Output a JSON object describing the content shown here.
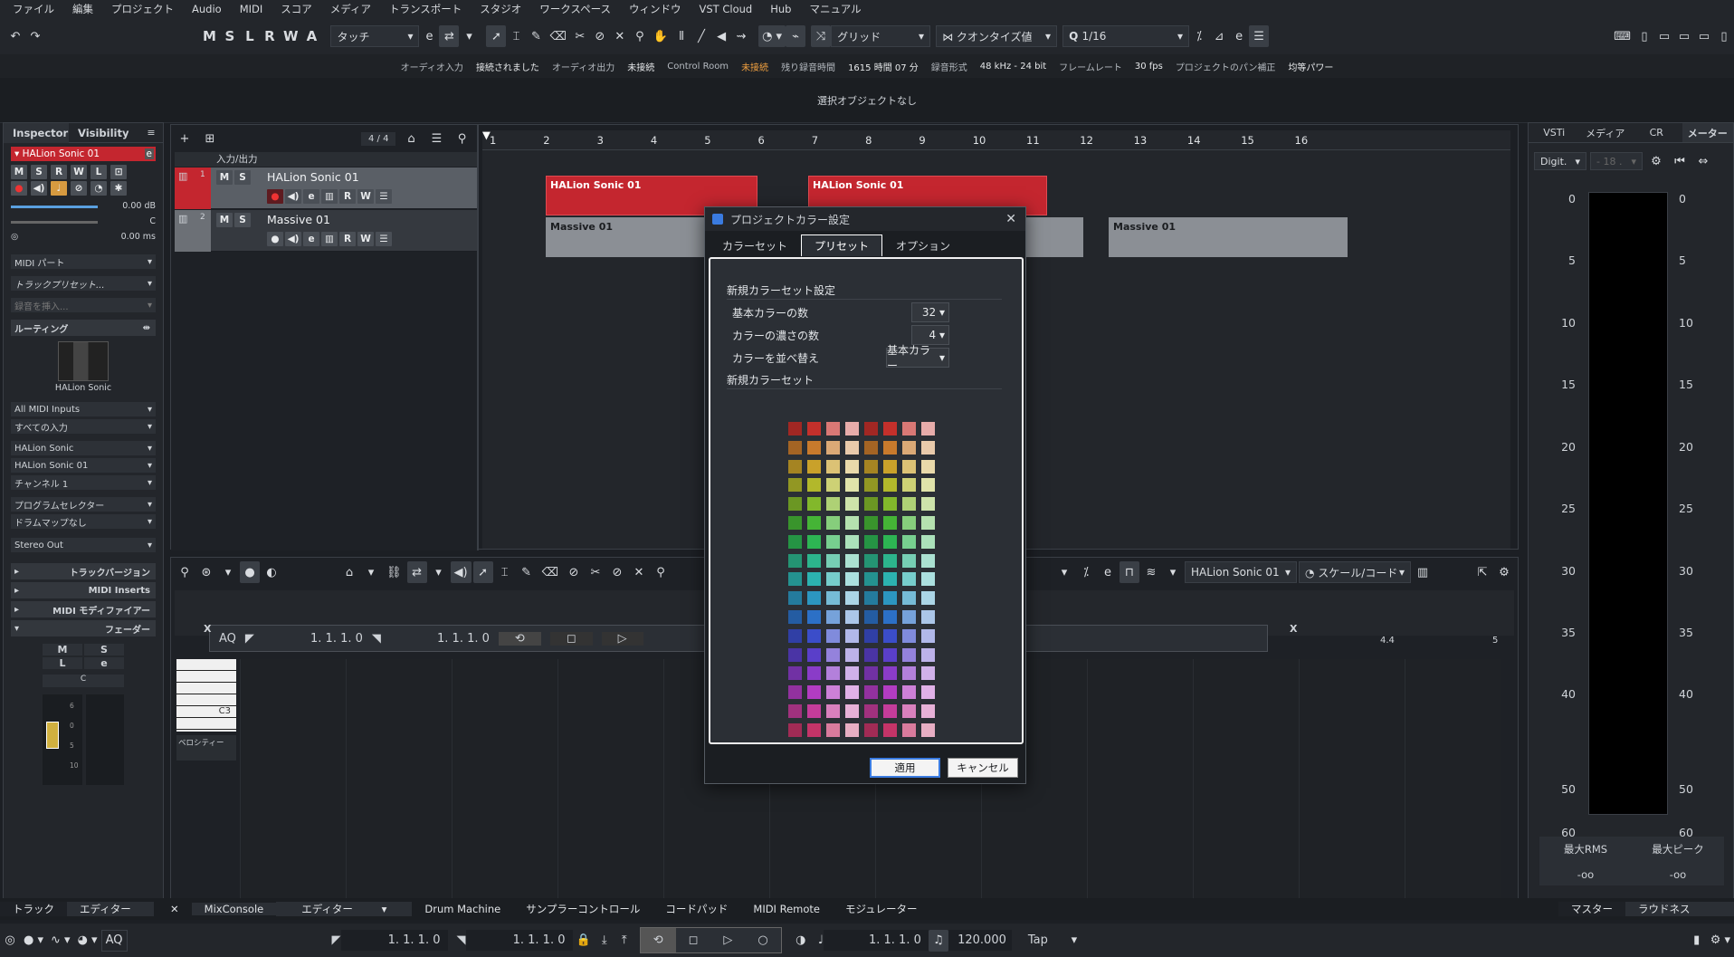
{
  "menu": [
    "ファイル",
    "編集",
    "プロジェクト",
    "Audio",
    "MIDI",
    "スコア",
    "メディア",
    "トランスポート",
    "スタジオ",
    "ワークスペース",
    "ウィンドウ",
    "VST Cloud",
    "Hub",
    "マニュアル"
  ],
  "toolbar": {
    "mslrwa": [
      "M",
      "S",
      "L",
      "R",
      "W",
      "A"
    ],
    "automation_mode": "タッチ",
    "snap_type": "グリッド",
    "quantize_type": "クオンタイズ値",
    "quantize_value": "1/16"
  },
  "status": [
    {
      "key": "オーディオ入力",
      "value": "接続されました",
      "warn": false
    },
    {
      "key": "オーディオ出力",
      "value": "未接続",
      "warn": false
    },
    {
      "key": "Control Room",
      "value": "未接続",
      "warn": true
    },
    {
      "key": "残り録音時間",
      "value": "1615 時間 07 分",
      "warn": false
    },
    {
      "key": "録音形式",
      "value": "48 kHz - 24 bit",
      "warn": false
    },
    {
      "key": "フレームレート",
      "value": "30 fps",
      "warn": false
    },
    {
      "key": "プロジェクトのパン補正",
      "value": "均等パワー",
      "warn": false
    }
  ],
  "info_line": "選択オブジェクトなし",
  "inspector": {
    "tabs": [
      "Inspector",
      "Visibility"
    ],
    "track_name": "HALion Sonic 01",
    "volume": "0.00 dB",
    "pan": "C",
    "delay": "0.00 ms",
    "midi_part": "MIDI パート",
    "track_preset": "トラックプリセット...",
    "insert_placeholder": "録音を挿入...",
    "routing": "ルーティング",
    "instrument_name": "HALion Sonic",
    "midi_input": "All MIDI Inputs",
    "all_inputs": "すべての入力",
    "instrument": "HALion Sonic",
    "instrument_out": "HALion Sonic 01",
    "channel": "チャンネル 1",
    "program_selector": "プログラムセレクター",
    "drum_map": "ドラムマップなし",
    "stereo_out": "Stereo Out",
    "sections": [
      "トラックバージョン",
      "MIDI Inserts",
      "MIDI モディファイアー",
      "フェーダー"
    ],
    "fader_buttons": [
      "M",
      "S",
      "L"
    ],
    "fader_value": "C",
    "fader_scale": [
      "6",
      "0",
      "5",
      "10"
    ]
  },
  "project": {
    "count": "4 / 4",
    "folder": "入力/出力",
    "tracks": [
      {
        "num": "1",
        "name": "HALion Sonic 01"
      },
      {
        "num": "2",
        "name": "Massive 01"
      }
    ],
    "ruler": [
      "1",
      "2",
      "3",
      "4",
      "5",
      "6",
      "7",
      "8",
      "9",
      "10",
      "11",
      "12",
      "13",
      "14",
      "15",
      "16"
    ],
    "events": [
      {
        "name": "HALion Sonic 01",
        "track": 0
      },
      {
        "name": "HALion Sonic 01",
        "track": 0
      },
      {
        "name": "Massive 01",
        "track": 1
      },
      {
        "name": "Massive 01",
        "track": 1
      }
    ]
  },
  "lower": {
    "aq": "AQ",
    "pos1": "1. 1. 1.   0",
    "pos2": "1. 1. 1.   0",
    "ruler_end": "4.4",
    "ruler_5": "5",
    "note_c3": "C3",
    "velocity": "ベロシティー",
    "instrument": "HALion Sonic 01",
    "scale": "スケール/コード"
  },
  "right": {
    "tabs": [
      "VSTi",
      "メディア",
      "CR",
      "メーター"
    ],
    "meter_mode": "Digit.",
    "meter_val": "- 18 .",
    "scale": [
      "0",
      "5",
      "10",
      "15",
      "20",
      "25",
      "30",
      "35",
      "40",
      "50",
      "60"
    ],
    "rms_label": "最大RMS",
    "peak_label": "最大ピーク",
    "rms_value": "-oo",
    "peak_value": "-oo"
  },
  "bottom_tabs": {
    "left": [
      "トラック",
      "エディター"
    ],
    "center": [
      "MixConsole",
      "エディター",
      "Drum Machine",
      "サンプラーコントロール",
      "コードパッド",
      "MIDI Remote",
      "モジュレーター"
    ],
    "right": [
      "マスター",
      "ラウドネス"
    ]
  },
  "transport": {
    "aq": "AQ",
    "left_locator": "1. 1. 1.   0",
    "right_locator": "1. 1. 1.   0",
    "position": "1. 1. 1.   0",
    "tempo": "120.000",
    "tap": "Tap"
  },
  "dialog": {
    "title": "プロジェクトカラー設定",
    "tabs": [
      "カラーセット",
      "プリセット",
      "オプション"
    ],
    "section1": "新規カラーセット設定",
    "base_count_label": "基本カラーの数",
    "base_count": "32",
    "shade_count_label": "カラーの濃さの数",
    "shade_count": "4",
    "sort_label": "カラーを並べ替え",
    "sort_value": "基本カラー",
    "section2": "新規カラーセット",
    "apply": "適用",
    "cancel": "キャンセル",
    "hues": [
      "#c4302b",
      "#c87a2c",
      "#c9a12a",
      "#b2b82b",
      "#82b82b",
      "#45b436",
      "#2db553",
      "#2cb48c",
      "#2cb2b0",
      "#2c96c0",
      "#2c70c6",
      "#3b4dc9",
      "#5a3fc9",
      "#8a3cc8",
      "#b23cc2",
      "#c43c9a",
      "#c43468"
    ]
  }
}
